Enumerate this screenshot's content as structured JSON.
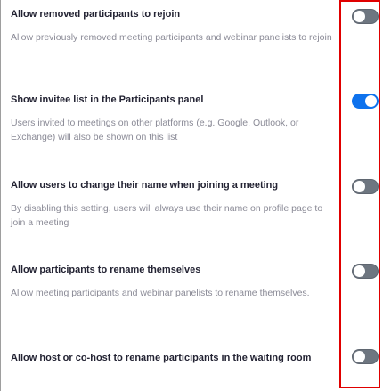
{
  "settings": [
    {
      "title": "Allow removed participants to rejoin",
      "description": "Allow previously removed meeting participants and webinar panelists to rejoin",
      "enabled": false
    },
    {
      "title": "Show invitee list in the Participants panel",
      "description": "Users invited to meetings on other platforms (e.g. Google, Outlook, or Exchange) will also be shown on this list",
      "enabled": true
    },
    {
      "title": "Allow users to change their name when joining a meeting",
      "description": "By disabling this setting, users will always use their name on profile page to join a meeting",
      "enabled": false
    },
    {
      "title": "Allow participants to rename themselves",
      "description": "Allow meeting participants and webinar panelists to rename themselves.",
      "enabled": false
    },
    {
      "title": "Allow host or co-host to rename participants in the waiting room",
      "description": "",
      "enabled": false
    }
  ],
  "colors": {
    "toggle_on": "#0e72ed",
    "toggle_off": "#6e7680",
    "highlight_border": "#e00000"
  }
}
